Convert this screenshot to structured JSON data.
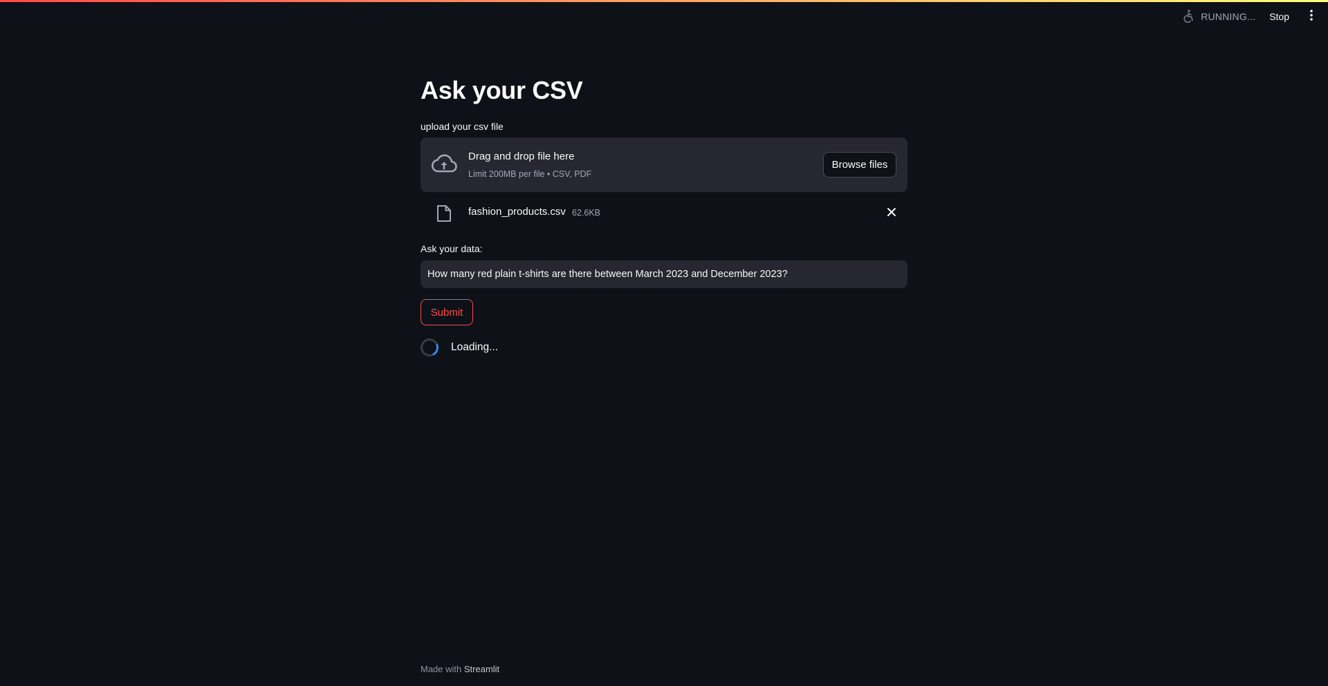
{
  "header": {
    "status_text": "RUNNING...",
    "stop_label": "Stop",
    "accent_gradient": [
      "#ff4b4b",
      "#fffd80"
    ]
  },
  "main": {
    "title": "Ask your CSV",
    "uploader": {
      "label": "upload your csv file",
      "dropzone_title": "Drag and drop file here",
      "dropzone_limit": "Limit 200MB per file • CSV, PDF",
      "browse_label": "Browse files",
      "icon": "cloud-upload-icon"
    },
    "uploaded_file": {
      "name": "fashion_products.csv",
      "size": "62.6KB",
      "icon": "file-icon"
    },
    "question": {
      "label": "Ask your data:",
      "value": "How many red plain t-shirts are there between March 2023 and December 2023?"
    },
    "submit_label": "Submit",
    "loading_text": "Loading..."
  },
  "footer": {
    "prefix": "Made with",
    "link": "Streamlit"
  },
  "colors": {
    "background": "#0e1117",
    "widget_background": "#262730",
    "primary": "#ff4b4b",
    "text": "#fafafa",
    "muted_text": "#a3a8b8",
    "spinner_accent": "#2e8cf0"
  }
}
